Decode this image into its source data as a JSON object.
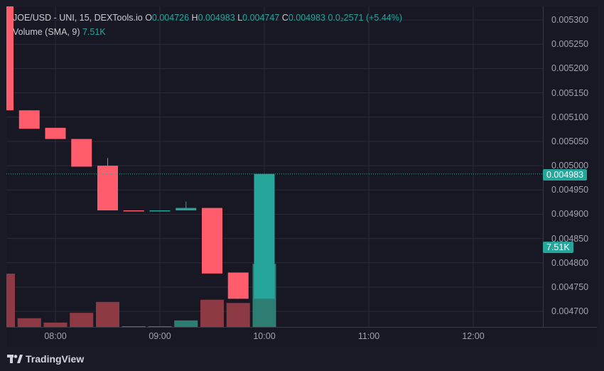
{
  "legend": {
    "symbol": "JOE/USD - UNI, 15, DEXTools.io",
    "open_key": "O",
    "open": "0.004726",
    "high_key": "H",
    "high": "0.004983",
    "low_key": "L",
    "low": "0.004747",
    "close_key": "C",
    "close": "0.004983",
    "change": "0.0₂2571 (+5.44%)",
    "volume_label": "Volume (SMA, 9)",
    "volume_value": "7.51K"
  },
  "price_axis": {
    "ticks": [
      "0.005300",
      "0.005250",
      "0.005200",
      "0.005150",
      "0.005100",
      "0.005050",
      "0.005000",
      "0.004950",
      "0.004900",
      "0.004850",
      "0.004800",
      "0.004750",
      "0.004700"
    ],
    "last_price": "0.004983",
    "volume_badge": "7.51K"
  },
  "time_axis": {
    "ticks": [
      "08:00",
      "09:00",
      "10:00",
      "11:00",
      "12:00"
    ]
  },
  "footer": {
    "brand": "TradingView"
  },
  "colors": {
    "up": "#26a69a",
    "down": "#ff5c6c",
    "up_volume": "#2e7d72",
    "down_volume": "#8e3a45",
    "background": "#181825",
    "grid": "#2a2a38"
  },
  "chart_data": {
    "type": "candlestick",
    "title": "JOE/USD - UNI, 15, DEXTools.io",
    "interval_minutes": 15,
    "ylim": [
      0.004668,
      0.005328
    ],
    "candles": [
      {
        "time": "07:30",
        "open": 0.0054,
        "high": 0.0054,
        "low": 0.005114,
        "close": 0.005114
      },
      {
        "time": "07:45",
        "open": 0.005114,
        "high": 0.005114,
        "low": 0.005076,
        "close": 0.005076
      },
      {
        "time": "08:00",
        "open": 0.005078,
        "high": 0.005078,
        "low": 0.005055,
        "close": 0.005055
      },
      {
        "time": "08:15",
        "open": 0.005055,
        "high": 0.005055,
        "low": 0.004998,
        "close": 0.004998
      },
      {
        "time": "08:30",
        "open": 0.005,
        "high": 0.005016,
        "low": 0.004908,
        "close": 0.004908
      },
      {
        "time": "08:45",
        "open": 0.004908,
        "high": 0.004908,
        "low": 0.004907,
        "close": 0.004907
      },
      {
        "time": "09:00",
        "open": 0.004907,
        "high": 0.004908,
        "low": 0.004907,
        "close": 0.004908
      },
      {
        "time": "09:15",
        "open": 0.004908,
        "high": 0.004926,
        "low": 0.004908,
        "close": 0.004913
      },
      {
        "time": "09:30",
        "open": 0.004913,
        "high": 0.004913,
        "low": 0.004778,
        "close": 0.004778
      },
      {
        "time": "09:45",
        "open": 0.00478,
        "high": 0.00478,
        "low": 0.004726,
        "close": 0.004726
      },
      {
        "time": "10:00",
        "open": 0.004726,
        "high": 0.004983,
        "low": 0.004726,
        "close": 0.004983
      }
    ],
    "volume": [
      {
        "time": "07:30",
        "value": 4.9,
        "direction": "down"
      },
      {
        "time": "07:45",
        "value": 0.8,
        "direction": "down"
      },
      {
        "time": "08:00",
        "value": 0.4,
        "direction": "down"
      },
      {
        "time": "08:15",
        "value": 1.3,
        "direction": "down"
      },
      {
        "time": "08:30",
        "value": 2.3,
        "direction": "down"
      },
      {
        "time": "08:45",
        "value": 0.03,
        "direction": "up"
      },
      {
        "time": "09:00",
        "value": 0.03,
        "direction": "up"
      },
      {
        "time": "09:15",
        "value": 0.6,
        "direction": "up"
      },
      {
        "time": "09:30",
        "value": 2.5,
        "direction": "down"
      },
      {
        "time": "09:45",
        "value": 2.2,
        "direction": "down"
      },
      {
        "time": "10:00",
        "value": 5.8,
        "direction": "up"
      }
    ],
    "volume_sma": "7.51K",
    "last_price": 0.004983,
    "grid": true
  }
}
